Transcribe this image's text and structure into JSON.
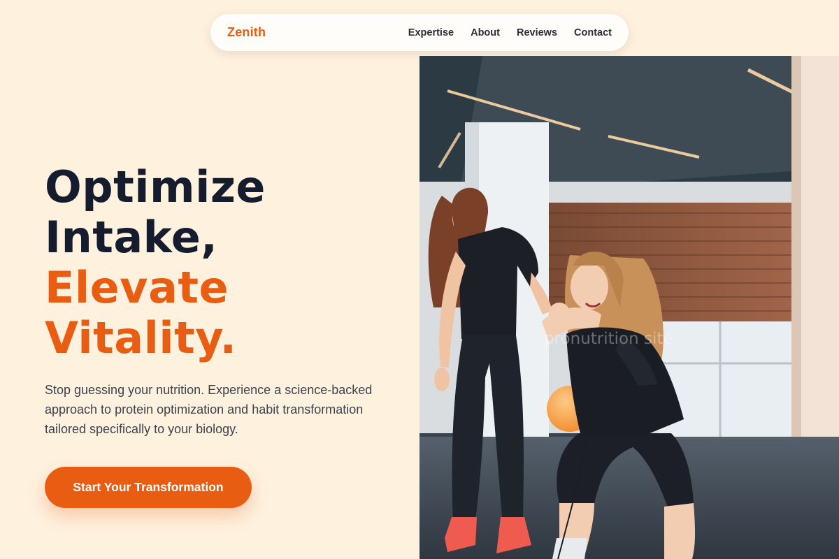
{
  "nav": {
    "brand": "Zenith",
    "links": [
      "Expertise",
      "About",
      "Reviews",
      "Contact"
    ]
  },
  "hero": {
    "headline_line1": "Optimize",
    "headline_line2": "Intake,",
    "headline_line3": "Elevate",
    "headline_line4": "Vitality.",
    "subtext": "Stop guessing your nutrition. Experience a science-backed approach to protein optimization and habit transformation tailored specifically to your biology.",
    "cta_label": "Start Your Transformation"
  },
  "photo": {
    "watermark": "pronutrition site"
  },
  "colors": {
    "background": "#fef1de",
    "accent": "#e85d12",
    "heading": "#151c2e",
    "body_text": "#3d424d"
  }
}
